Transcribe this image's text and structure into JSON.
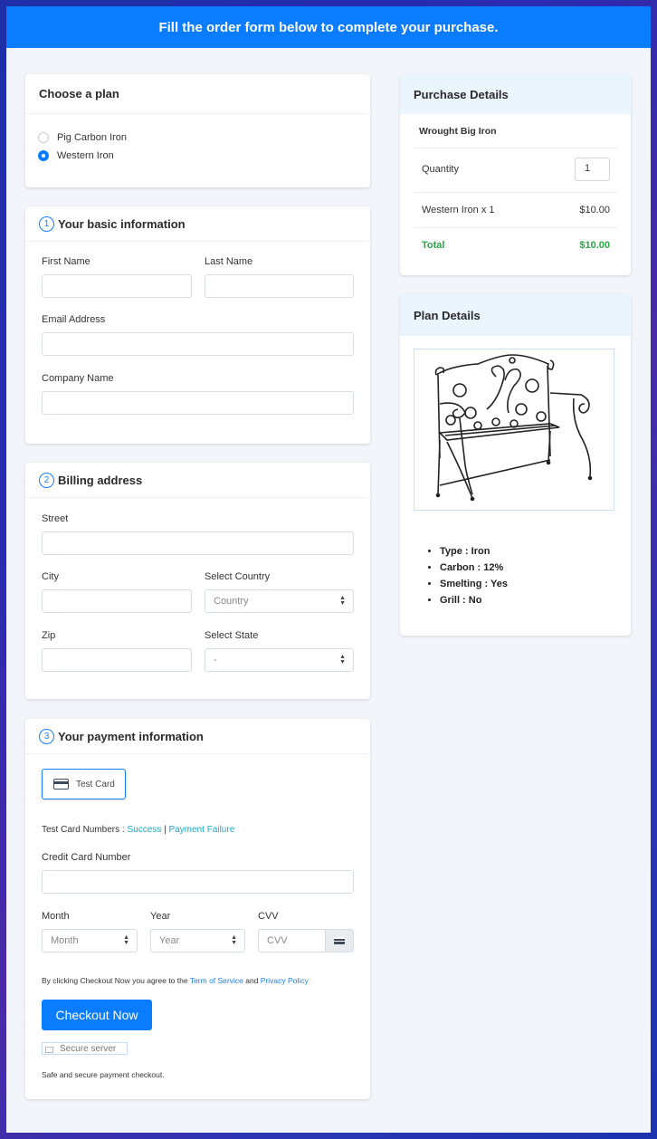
{
  "banner": {
    "title": "Fill the order form below to complete your purchase."
  },
  "plan": {
    "title": "Choose a plan",
    "options": [
      {
        "label": "Pig Carbon Iron",
        "selected": false
      },
      {
        "label": "Western Iron",
        "selected": true
      }
    ]
  },
  "basic_info": {
    "step": "1",
    "title": "Your basic information",
    "first_name_label": "First Name",
    "last_name_label": "Last Name",
    "email_label": "Email Address",
    "company_label": "Company Name",
    "first_name_value": "",
    "last_name_value": "",
    "email_value": "",
    "company_value": ""
  },
  "billing": {
    "step": "2",
    "title": "Billing address",
    "street_label": "Street",
    "city_label": "City",
    "country_label": "Select Country",
    "country_value": "Country",
    "zip_label": "Zip",
    "state_label": "Select State",
    "state_value": "-"
  },
  "payment": {
    "step": "3",
    "title": "Your payment information",
    "card_button_label": "Test Card",
    "test_numbers_prefix": "Test Card Numbers :",
    "success_link": "Success",
    "divider": "|",
    "failure_link": "Payment Failure",
    "card_number_label": "Credit Card Number",
    "month_label": "Month",
    "month_value": "Month",
    "year_label": "Year",
    "year_value": "Year",
    "cvv_label": "CVV",
    "cvv_placeholder": "CVV",
    "agree_prefix": "By clicking Checkout Now you agree to the",
    "terms_link": "Term of Service",
    "agree_and": "and",
    "privacy_link": "Privacy Policy",
    "checkout_label": "Checkout Now",
    "secure_badge": "Secure server",
    "safe_text": "Safe and secure payment checkout."
  },
  "purchase": {
    "title": "Purchase Details",
    "product": "Wrought Big Iron",
    "quantity_label": "Quantity",
    "quantity_value": "1",
    "line_item": "Western Iron x 1",
    "line_price": "$10.00",
    "total_label": "Total",
    "total_value": "$10.00"
  },
  "plan_details": {
    "title": "Plan Details",
    "image_alt": "wrought iron bench",
    "specs": [
      "Type : Iron",
      "Carbon : 12%",
      "Smelting : Yes",
      "Grill : No"
    ]
  },
  "colors": {
    "primary": "#0a7cff",
    "total_green": "#28a745",
    "link_teal": "#19a7c9"
  }
}
